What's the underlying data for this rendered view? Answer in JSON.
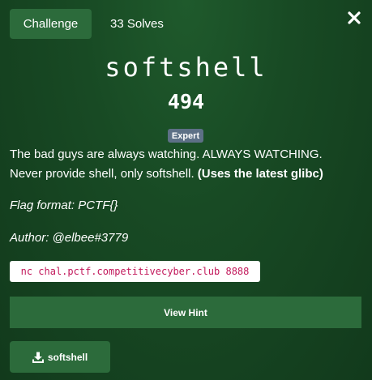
{
  "tabs": {
    "challenge_label": "Challenge",
    "solves_label": "33 Solves"
  },
  "close": {
    "icon": "close-icon"
  },
  "challenge": {
    "name": "softshell",
    "points": "494",
    "difficulty": "Expert",
    "description_line1": "The bad guys are always watching. ALWAYS WATCHING.",
    "description_line2": "Never provide shell, only softshell.",
    "description_bold": "(Uses the latest glibc)",
    "flag_format": "Flag format: PCTF{}",
    "author": "Author: @elbee#3779",
    "connection": "nc chal.pctf.competitivecyber.club 8888"
  },
  "buttons": {
    "hint_label": "View Hint",
    "file_label": "softshell",
    "file_icon": "download-icon"
  },
  "colors": {
    "accent": "#2c6b3b",
    "badge": "#5d7086",
    "code_text": "#c2185b"
  }
}
